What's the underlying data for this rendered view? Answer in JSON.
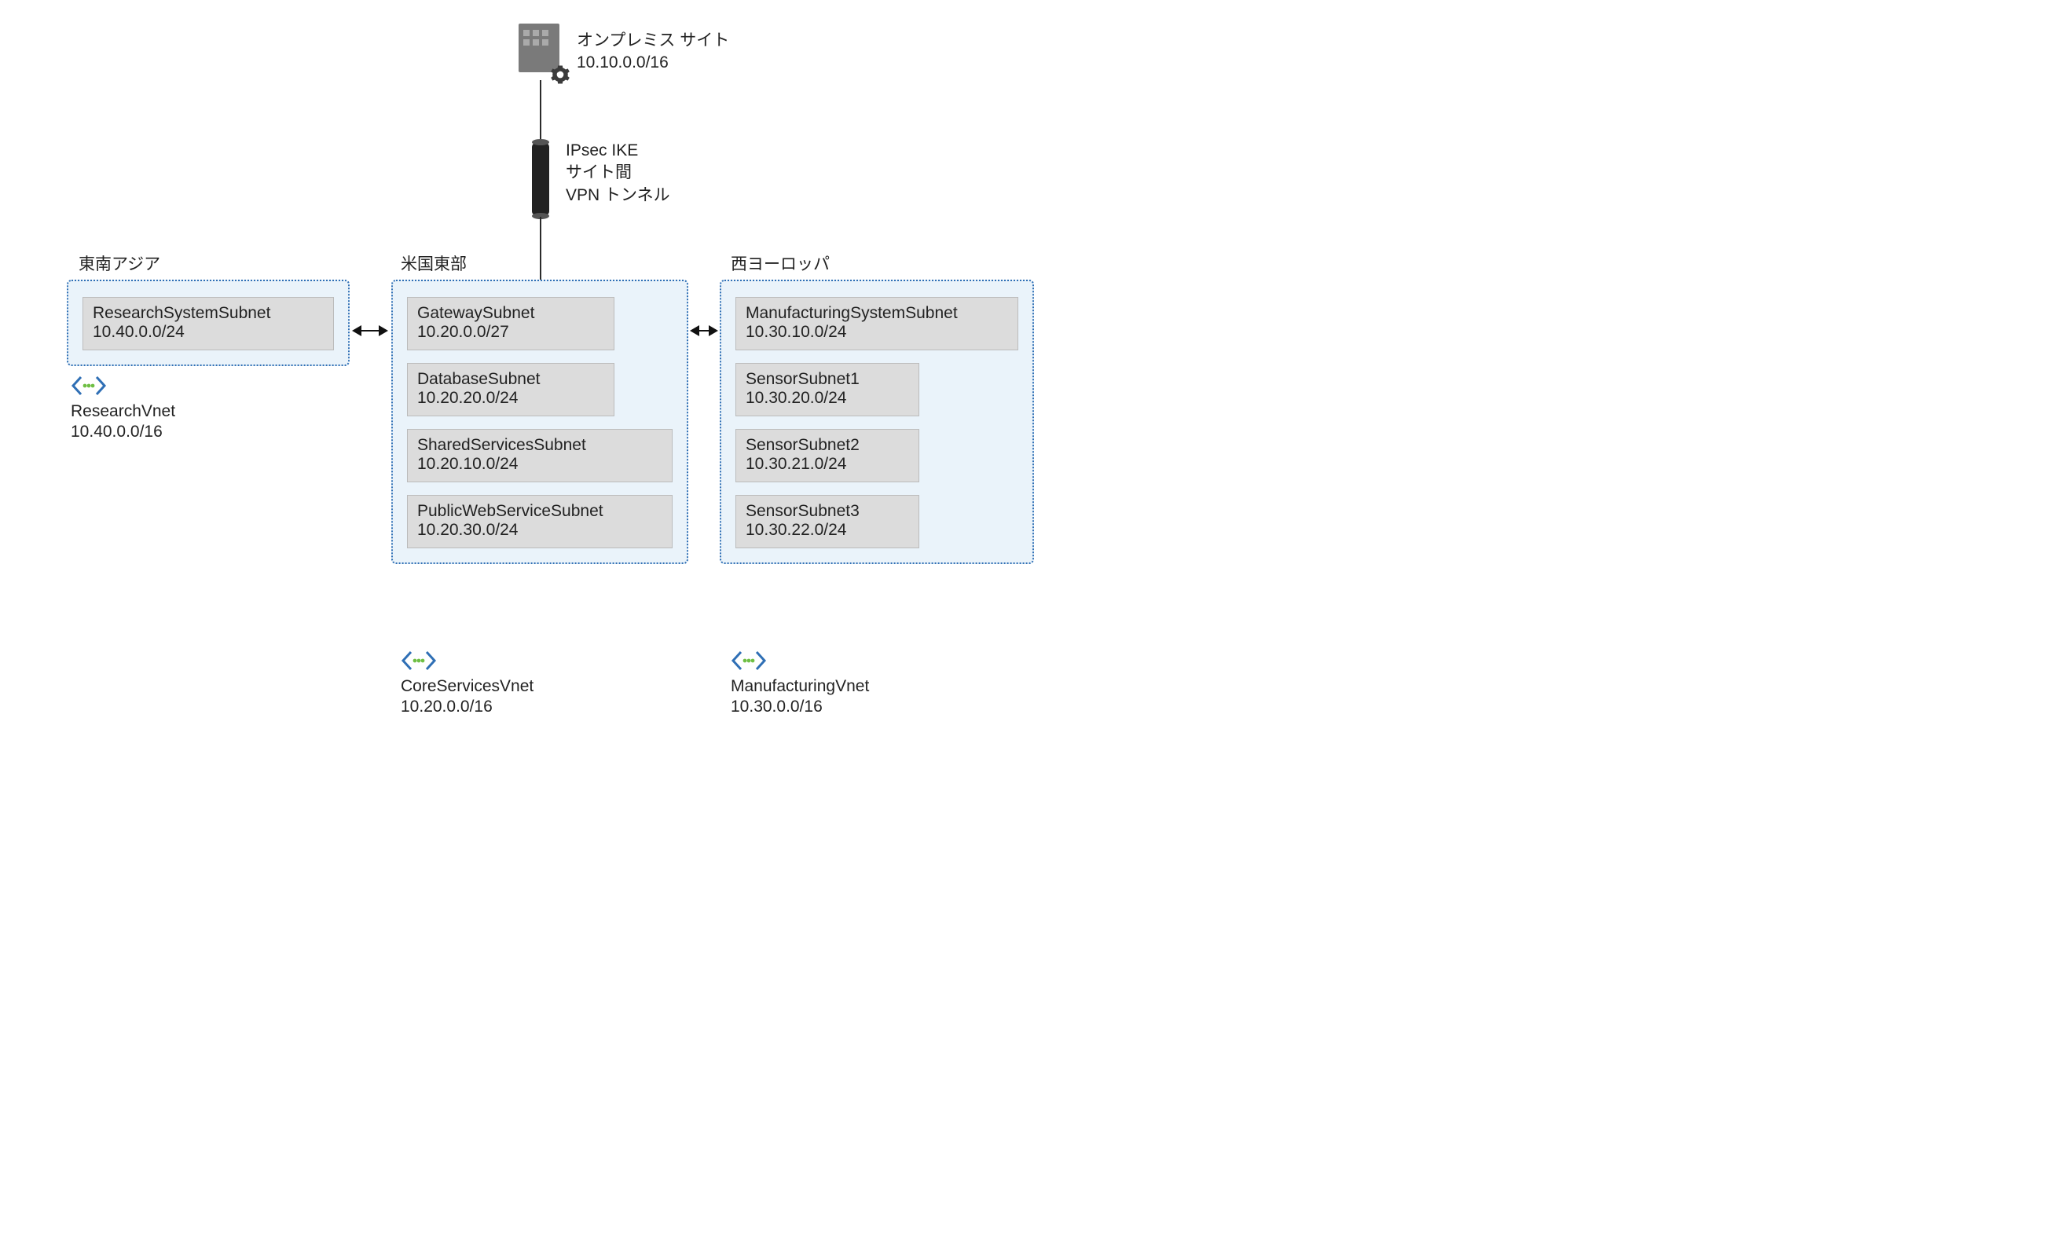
{
  "onprem": {
    "title": "オンプレミス サイト",
    "cidr": "10.10.0.0/16"
  },
  "vpn": {
    "line1": "IPsec IKE",
    "line2": "サイト間",
    "line3": "VPN トンネル"
  },
  "regions": {
    "sea": "東南アジア",
    "eus": "米国東部",
    "weu": "西ヨーロッパ"
  },
  "vnets": {
    "sea": {
      "name": "ResearchVnet",
      "cidr": "10.40.0.0/16",
      "subnets": [
        {
          "name": "ResearchSystemSubnet",
          "cidr": "10.40.0.0/24"
        }
      ]
    },
    "eus": {
      "name": "CoreServicesVnet",
      "cidr": "10.20.0.0/16",
      "subnets": [
        {
          "name": "GatewaySubnet",
          "cidr": "10.20.0.0/27"
        },
        {
          "name": "DatabaseSubnet",
          "cidr": "10.20.20.0/24"
        },
        {
          "name": "SharedServicesSubnet",
          "cidr": "10.20.10.0/24"
        },
        {
          "name": "PublicWebServiceSubnet",
          "cidr": "10.20.30.0/24"
        }
      ]
    },
    "weu": {
      "name": "ManufacturingVnet",
      "cidr": "10.30.0.0/16",
      "subnets": [
        {
          "name": "ManufacturingSystemSubnet",
          "cidr": "10.30.10.0/24"
        },
        {
          "name": "SensorSubnet1",
          "cidr": "10.30.20.0/24"
        },
        {
          "name": "SensorSubnet2",
          "cidr": "10.30.21.0/24"
        },
        {
          "name": "SensorSubnet3",
          "cidr": "10.30.22.0/24"
        }
      ]
    }
  }
}
